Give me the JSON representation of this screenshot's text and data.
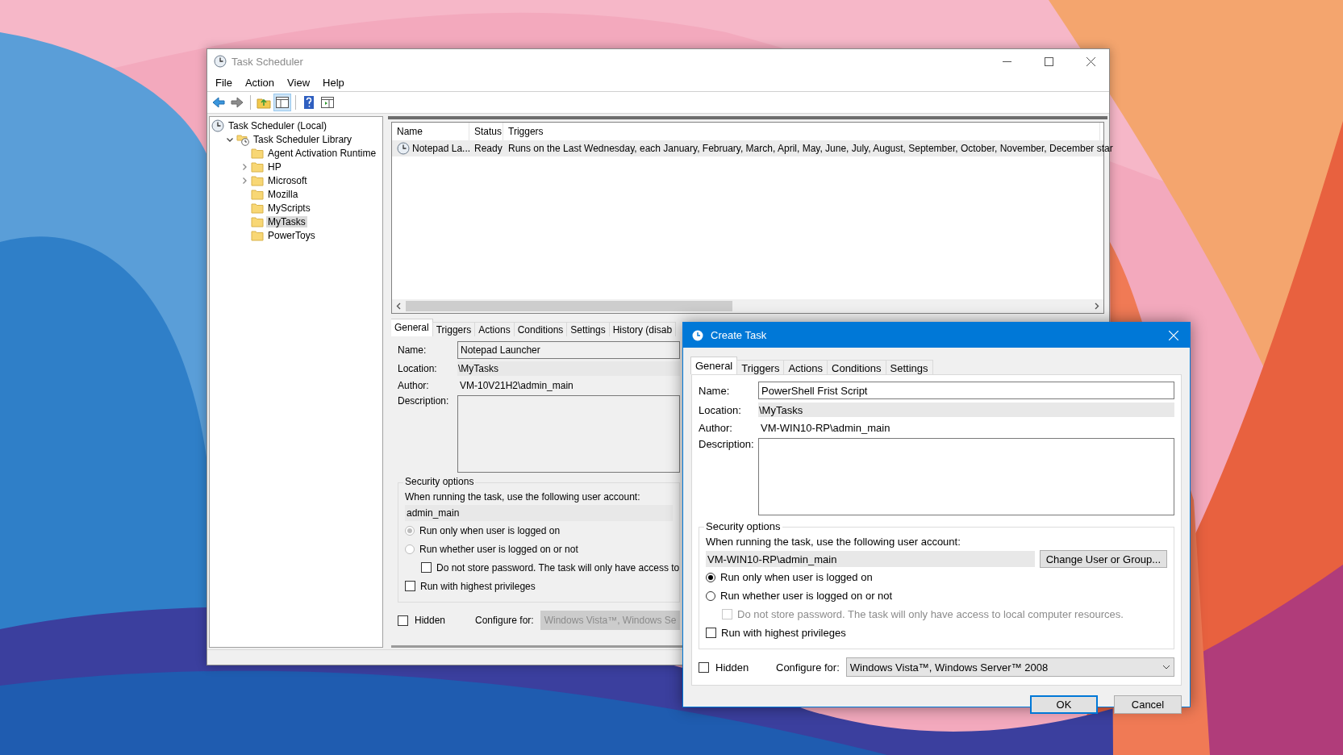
{
  "main_window": {
    "title": "Task Scheduler",
    "menu": [
      "File",
      "Action",
      "View",
      "Help"
    ],
    "tree": [
      {
        "label": "Task Scheduler (Local)",
        "selected": false,
        "children": [
          {
            "label": "Task Scheduler Library",
            "selected": false,
            "expanded": true,
            "children": [
              {
                "label": "Agent Activation Runtime",
                "selected": false
              },
              {
                "label": "HP",
                "selected": false,
                "expanded": false
              },
              {
                "label": "Microsoft",
                "selected": false,
                "expanded": false
              },
              {
                "label": "Mozilla",
                "selected": false
              },
              {
                "label": "MyScripts",
                "selected": false
              },
              {
                "label": "MyTasks",
                "selected": true
              },
              {
                "label": "PowerToys",
                "selected": false
              }
            ]
          }
        ]
      }
    ],
    "task_list": {
      "columns": [
        "Name",
        "Status",
        "Triggers"
      ],
      "rows": [
        {
          "cells": [
            "Notepad La...",
            "Ready",
            "Runs on the Last Wednesday, each January, February, March, April, May, June, July, August, September, October, November, December star"
          ],
          "selected": true
        }
      ]
    },
    "detail": {
      "tabs": [
        {
          "label": "General",
          "selected": true
        },
        {
          "label": "Triggers",
          "selected": false
        },
        {
          "label": "Actions",
          "selected": false
        },
        {
          "label": "Conditions",
          "selected": false
        },
        {
          "label": "Settings",
          "selected": false
        },
        {
          "label": "History (disab",
          "selected": false
        }
      ],
      "fields": [
        {
          "kind": "input",
          "label": "Name:",
          "value": "Notepad Launcher"
        },
        {
          "kind": "readonly",
          "label": "Location:",
          "value": "\\MyTasks"
        },
        {
          "kind": "text",
          "label": "Author:",
          "value": "VM-10V21H2\\admin_main"
        },
        {
          "kind": "textarea",
          "label": "Description:"
        }
      ],
      "security": {
        "title": "Security options",
        "prompt": "When running the task, use the following user account:",
        "account": "admin_main",
        "options": [
          {
            "label": "Run only when user is logged on",
            "selected": true,
            "disabled": true
          },
          {
            "label": "Run whether user is logged on or not",
            "selected": false,
            "disabled": true
          }
        ],
        "no_password": {
          "label": "Do not store password.  The task will only have access to",
          "checked": false,
          "disabled": false
        },
        "highest_privileges": {
          "label": "Run with highest privileges",
          "checked": false
        }
      },
      "hidden": {
        "label": "Hidden",
        "checked": false
      },
      "configure": {
        "label": "Configure for:",
        "value": "Windows Vista™, Windows Se",
        "disabled": true
      }
    }
  },
  "dialog": {
    "title": "Create Task",
    "tabs": [
      {
        "label": "General",
        "selected": true
      },
      {
        "label": "Triggers",
        "selected": false
      },
      {
        "label": "Actions",
        "selected": false
      },
      {
        "label": "Conditions",
        "selected": false
      },
      {
        "label": "Settings",
        "selected": false
      }
    ],
    "fields": [
      {
        "kind": "input",
        "label": "Name:",
        "value": "PowerShell Frist Script"
      },
      {
        "kind": "readonly",
        "label": "Location:",
        "value": "\\MyTasks"
      },
      {
        "kind": "text",
        "label": "Author:",
        "value": "VM-WIN10-RP\\admin_main"
      },
      {
        "kind": "textarea",
        "label": "Description:"
      }
    ],
    "security": {
      "title": "Security options",
      "prompt": "When running the task, use the following user account:",
      "account": "VM-WIN10-RP\\admin_main",
      "change_button": "Change User or Group...",
      "options": [
        {
          "label": "Run only when user is logged on",
          "selected": true,
          "disabled": false
        },
        {
          "label": "Run whether user is logged on or not",
          "selected": false,
          "disabled": false
        }
      ],
      "no_password": {
        "label": "Do not store password.  The task will only have access to local computer resources.",
        "checked": false,
        "disabled": true
      },
      "highest_privileges": {
        "label": "Run with highest privileges",
        "checked": false
      }
    },
    "hidden": {
      "label": "Hidden",
      "checked": false
    },
    "configure": {
      "label": "Configure for:",
      "value": "Windows Vista™, Windows Server™ 2008",
      "disabled": false
    },
    "buttons": [
      {
        "label": "OK",
        "default": true
      },
      {
        "label": "Cancel",
        "default": false
      }
    ]
  }
}
